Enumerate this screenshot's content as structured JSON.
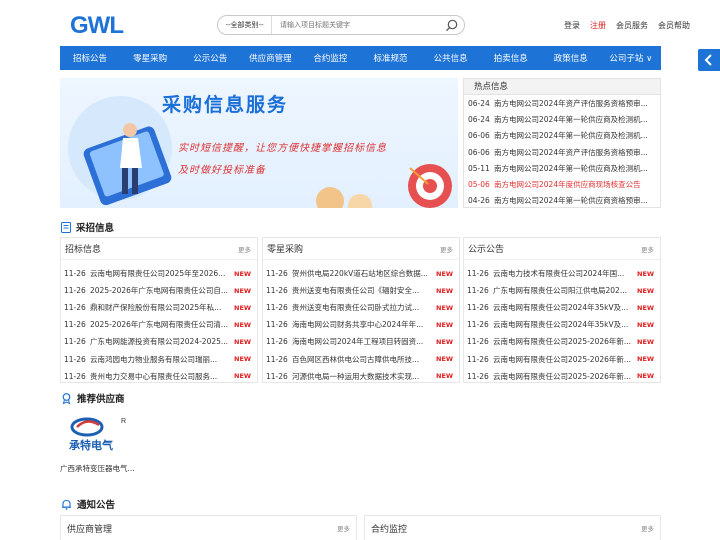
{
  "header": {
    "logo_text": "GWL",
    "search": {
      "category": "--全部类别--",
      "placeholder": "请输入项目标题关键字"
    },
    "links": [
      "登录",
      "注册",
      "会员服务",
      "会员帮助"
    ]
  },
  "nav": [
    "招标公告",
    "零星采购",
    "公示公告",
    "供应商管理",
    "合约监控",
    "标准规范",
    "公共信息",
    "拍卖信息",
    "政策信息",
    "公司子站 ∨"
  ],
  "banner": {
    "title": "采购信息服务",
    "subtitle_line1": "实时短信提醒，让您方便快捷掌握招标信息",
    "subtitle_line2": "及时做好投标准备"
  },
  "hot": {
    "title": "热点信息",
    "items": [
      {
        "date": "06-24",
        "text": "南方电网公司2024年资产评估服务资格预审...",
        "highlight": false
      },
      {
        "date": "06-24",
        "text": "南方电网公司2024年第一轮供应商及检测机...",
        "highlight": false
      },
      {
        "date": "06-06",
        "text": "南方电网公司2024年第一轮供应商及检测机...",
        "highlight": false
      },
      {
        "date": "06-06",
        "text": "南方电网公司2024年资产评估服务资格预审...",
        "highlight": false
      },
      {
        "date": "05-11",
        "text": "南方电网公司2024年第一轮供应商及检测机...",
        "highlight": false
      },
      {
        "date": "05-06",
        "text": "南方电网公司2024年度供应商现场核查公告",
        "highlight": true
      },
      {
        "date": "04-26",
        "text": "南方电网公司2024年第一轮供应商资格预审...",
        "highlight": false
      }
    ]
  },
  "sections": {
    "tender": "采招信息",
    "supplier": "推荐供应商",
    "notice": "通知公告"
  },
  "panels": [
    {
      "name": "招标信息",
      "more": "更多",
      "items": [
        {
          "date": "11-26",
          "text": "云南电网有限责任公司2025年至2026...",
          "badge": "NEW"
        },
        {
          "date": "11-26",
          "text": "2025-2026年广东电网有限责任公司自...",
          "badge": "NEW"
        },
        {
          "date": "11-26",
          "text": "鼎和财产保险股份有限公司2025年私...",
          "badge": "NEW"
        },
        {
          "date": "11-26",
          "text": "2025-2026年广东电网有限责任公司清...",
          "badge": "NEW"
        },
        {
          "date": "11-26",
          "text": "广东电网能源投资有限公司2024-2025...",
          "badge": "NEW"
        },
        {
          "date": "11-26",
          "text": "云南鸿园电力物业服务有限公司瑞丽...",
          "badge": "NEW"
        },
        {
          "date": "11-26",
          "text": "贵州电力交易中心有限责任公司服务...",
          "badge": "NEW"
        }
      ]
    },
    {
      "name": "零星采购",
      "more": "更多",
      "items": [
        {
          "date": "11-26",
          "text": "贺州供电局220kV道石站地区综合数据...",
          "badge": "NEW"
        },
        {
          "date": "11-26",
          "text": "贵州送变电有限责任公司《辐射安全...",
          "badge": "NEW"
        },
        {
          "date": "11-26",
          "text": "贵州送变电有限责任公司卧式拉力试...",
          "badge": "NEW"
        },
        {
          "date": "11-26",
          "text": "海南电网公司财务共享中心2024年年...",
          "badge": "NEW"
        },
        {
          "date": "11-26",
          "text": "海南电网公司2024年工程项目转固资...",
          "badge": "NEW"
        },
        {
          "date": "11-26",
          "text": "百色网区西林供电公司古障供电所技...",
          "badge": "NEW"
        },
        {
          "date": "11-26",
          "text": "河源供电局一种运用大数据技术实现...",
          "badge": "NEW"
        }
      ]
    },
    {
      "name": "公示公告",
      "more": "更多",
      "items": [
        {
          "date": "11-26",
          "text": "云南电力技术有限责任公司2024年国...",
          "badge": "NEW"
        },
        {
          "date": "11-26",
          "text": "广东电网有限责任公司阳江供电局202...",
          "badge": "NEW"
        },
        {
          "date": "11-26",
          "text": "云南电网有限责任公司2024年35kV及...",
          "badge": "NEW"
        },
        {
          "date": "11-26",
          "text": "云南电网有限责任公司2024年35kV及...",
          "badge": "NEW"
        },
        {
          "date": "11-26",
          "text": "云南电网有限责任公司2025-2026年新...",
          "badge": "NEW"
        },
        {
          "date": "11-26",
          "text": "云南电网有限责任公司2025-2026年新...",
          "badge": "NEW"
        },
        {
          "date": "11-26",
          "text": "云南电网有限责任公司2025-2026年新...",
          "badge": "NEW"
        }
      ]
    }
  ],
  "supplier": {
    "logo_text": "承特电气",
    "name": "广西承特变压器电气..."
  },
  "notice_panels": [
    {
      "name": "供应商管理",
      "more": "更多"
    },
    {
      "name": "合约监控",
      "more": "更多"
    }
  ],
  "colors": {
    "brand": "#1d73d6",
    "accent_red": "#e02020"
  }
}
